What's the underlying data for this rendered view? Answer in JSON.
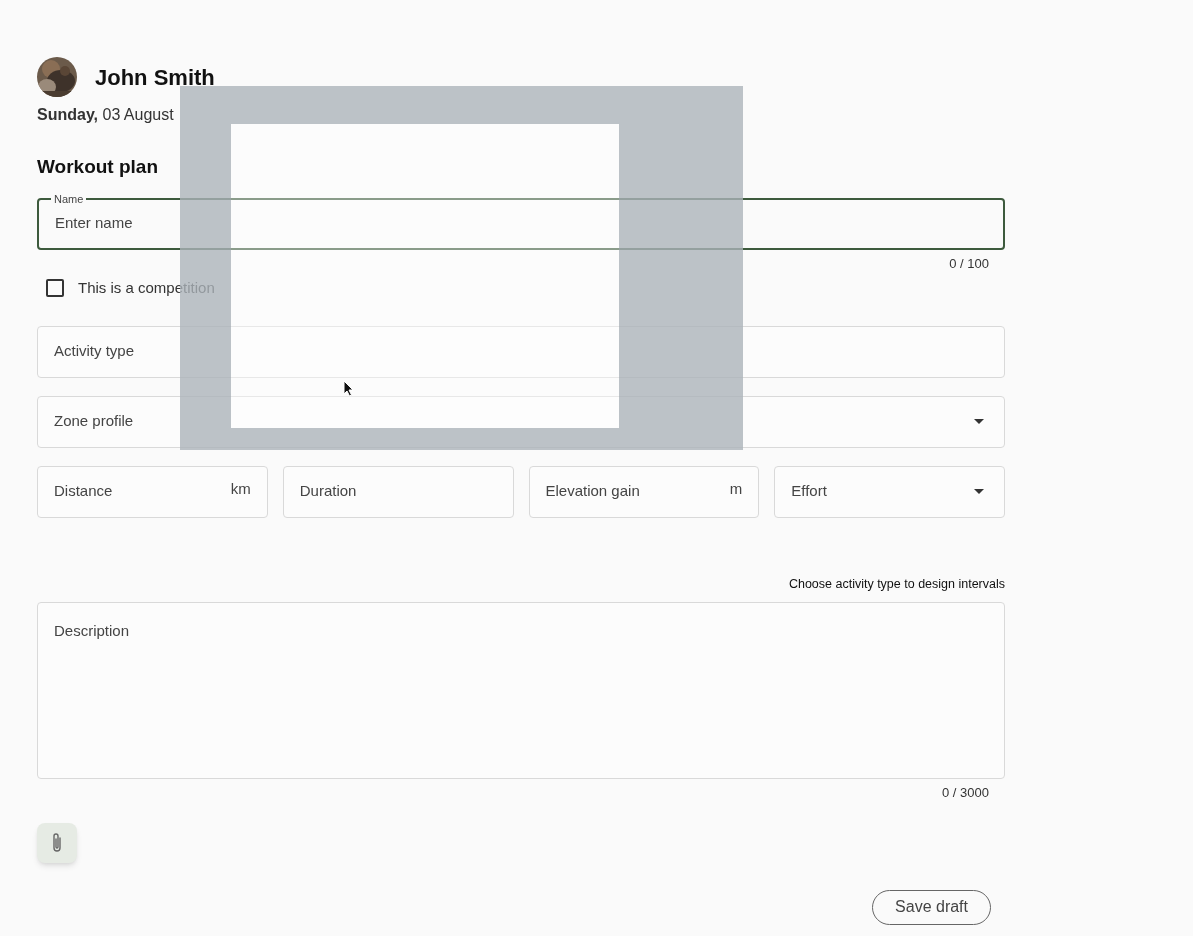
{
  "user": {
    "name": "John Smith"
  },
  "date": {
    "weekday": "Sunday,",
    "day": "03 August"
  },
  "section_title": "Workout plan",
  "name_field": {
    "label": "Name",
    "placeholder": "Enter name",
    "focused": true,
    "counter": "0 / 100"
  },
  "competition": {
    "label": "This is a competition",
    "checked": false
  },
  "fields": [
    {
      "placeholder": "Activity type",
      "dropdown": false
    },
    {
      "placeholder": "Zone profile",
      "dropdown": true
    }
  ],
  "metrics": [
    {
      "placeholder": "Distance",
      "unit": "km",
      "dropdown": false
    },
    {
      "placeholder": "Duration",
      "dropdown": false
    },
    {
      "placeholder": "Elevation gain",
      "unit": "m",
      "dropdown": false
    },
    {
      "placeholder": "Effort",
      "dropdown": true
    }
  ],
  "intervals_hint": "Choose activity type to design intervals",
  "description": {
    "placeholder": "Description",
    "counter": "0 / 3000"
  },
  "save_button": "Save draft"
}
